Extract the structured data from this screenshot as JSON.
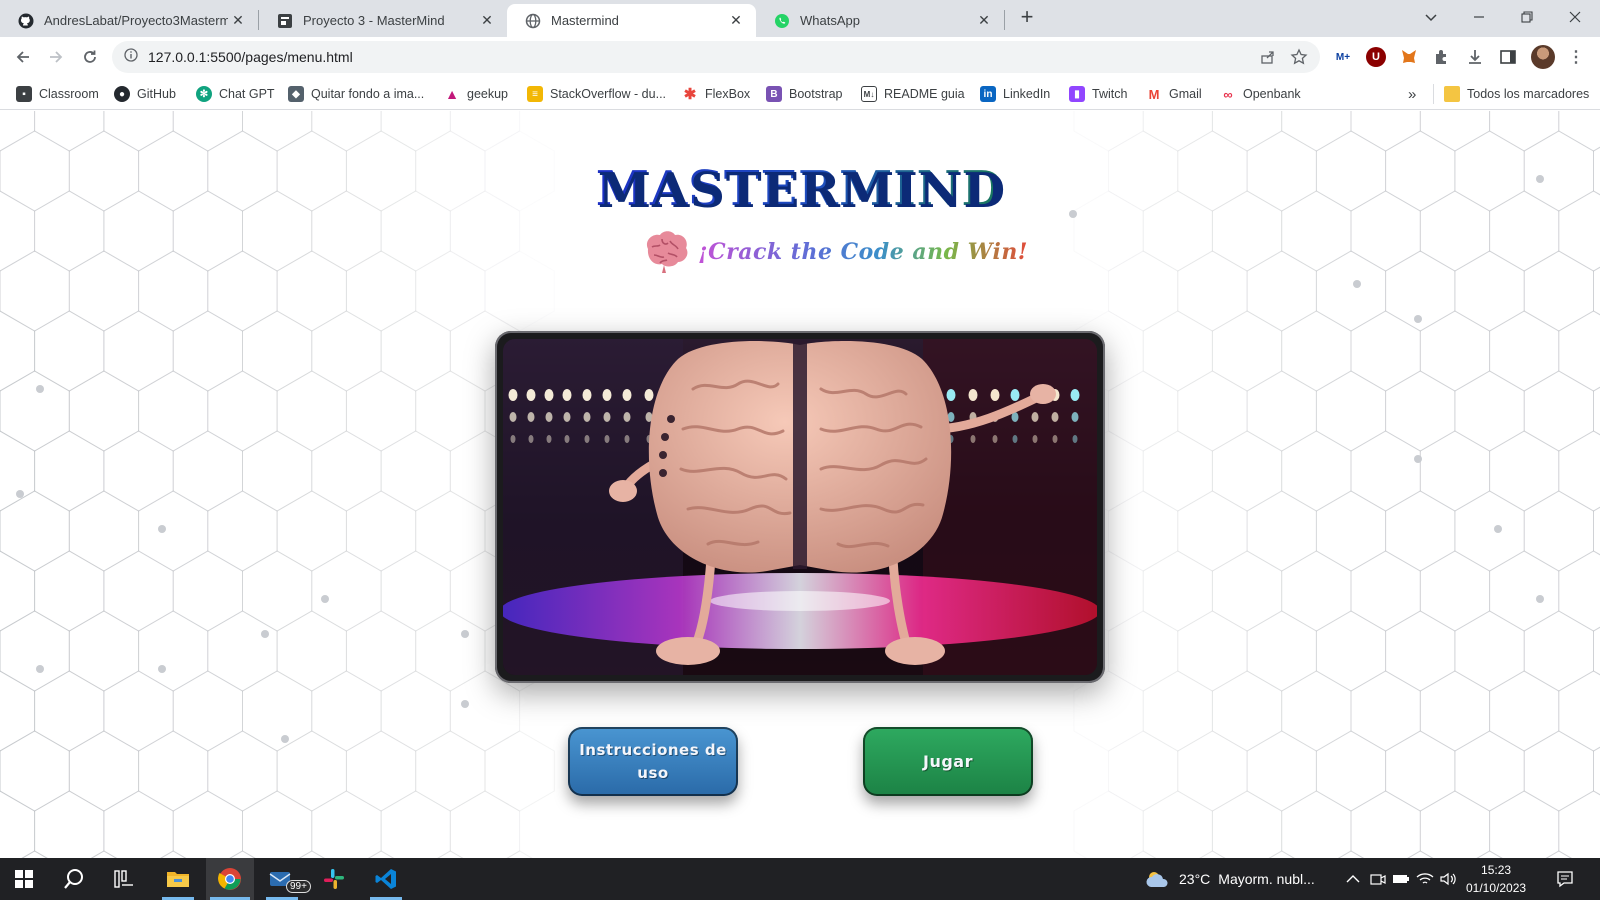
{
  "browser": {
    "tabs": [
      {
        "title": "AndresLabat/Proyecto3Masterm",
        "icon": "github-icon",
        "active": false
      },
      {
        "title": "Proyecto 3 - MasterMind",
        "icon": "notion-icon",
        "active": false
      },
      {
        "title": "Mastermind",
        "icon": "globe-icon",
        "active": true
      },
      {
        "title": "WhatsApp",
        "icon": "whatsapp-icon",
        "active": false
      }
    ],
    "new_tab_label": "+",
    "url": "127.0.0.1:5500/pages/menu.html",
    "bookmarks": [
      {
        "label": "Classroom",
        "icon": "classroom-icon",
        "color": "#3c4043"
      },
      {
        "label": "GitHub",
        "icon": "github-icon",
        "color": "#24292f"
      },
      {
        "label": "Chat GPT",
        "icon": "chatgpt-icon",
        "color": "#10a37f"
      },
      {
        "label": "Quitar fondo a ima...",
        "icon": "removebg-icon",
        "color": "#54616c"
      },
      {
        "label": "geekup",
        "icon": "geekup-icon",
        "color": "#c2187a"
      },
      {
        "label": "StackOverflow - du...",
        "icon": "stackoverflow-icon",
        "color": "#f2b705"
      },
      {
        "label": "FlexBox",
        "icon": "flexbox-icon",
        "color": "#e8453c"
      },
      {
        "label": "Bootstrap",
        "icon": "bootstrap-icon",
        "color": "#7952b3"
      },
      {
        "label": "README guia",
        "icon": "readme-icon",
        "color": "#3c4043"
      },
      {
        "label": "LinkedIn",
        "icon": "linkedin-icon",
        "color": "#0a66c2"
      },
      {
        "label": "Twitch",
        "icon": "twitch-icon",
        "color": "#9146ff"
      },
      {
        "label": "Gmail",
        "icon": "gmail-icon",
        "color": "#ea4335"
      },
      {
        "label": "Openbank",
        "icon": "openbank-icon",
        "color": "#e8344e"
      }
    ],
    "overflow_label": "»",
    "all_bookmarks_label": "Todos los marcadores"
  },
  "page": {
    "title": "MASTERMIND",
    "tagline": "¡Crack the Code and Win!",
    "buttons": {
      "instructions": "Instrucciones de uso",
      "play": "Jugar"
    }
  },
  "taskbar": {
    "badge_count": "99+",
    "weather_temp": "23°C",
    "weather_text": "Mayorm. nubl...",
    "time": "15:23",
    "date": "01/10/2023"
  },
  "colors": {
    "title_blue": "#1a3fb0",
    "play_green": "#1f9150",
    "instructions_blue": "#2e7cbf",
    "taskbar": "#202124",
    "active_indicator": "#76b9ed"
  }
}
